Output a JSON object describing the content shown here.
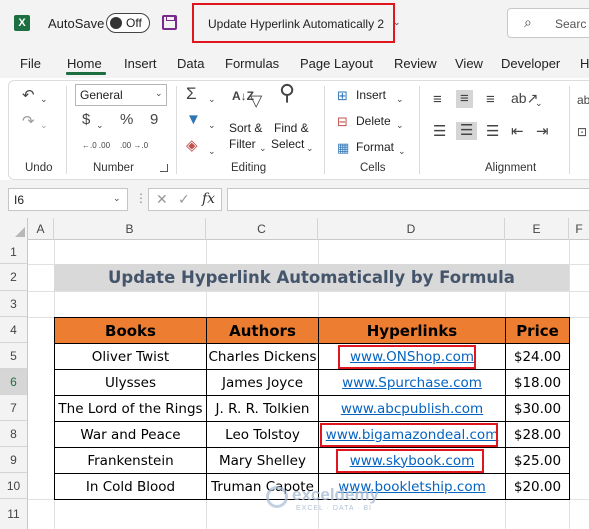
{
  "titlebar": {
    "app_icon": "X",
    "autosave_label": "AutoSave",
    "autosave_state": "Off",
    "document_title": "Update Hyperlink Automatically 2",
    "search_placeholder": "Searc"
  },
  "menu": {
    "tabs": [
      "File",
      "Home",
      "Insert",
      "Data",
      "Formulas",
      "Page Layout",
      "Review",
      "View",
      "Developer",
      "H"
    ],
    "active": "Home"
  },
  "ribbon": {
    "undo": {
      "label": "Undo"
    },
    "number": {
      "format": "General",
      "currency_icon": "$",
      "percent_icon": "%",
      "comma_icon": "9",
      "increase_decimal": "←.0 .00",
      "decrease_decimal": ".00 →.0",
      "label": "Number"
    },
    "editing": {
      "autosum_icon": "Σ",
      "sort_filter": [
        "Sort &",
        "Filter"
      ],
      "find_select": [
        "Find &",
        "Select"
      ],
      "label": "Editing"
    },
    "cells": {
      "insert": "Insert",
      "delete": "Delete",
      "format": "Format",
      "label": "Cells"
    },
    "alignment": {
      "label": "Alignment"
    }
  },
  "formula_bar": {
    "name_box": "I6",
    "fx": "fx",
    "cancel_icon": "✕",
    "enter_icon": "✓",
    "formula": ""
  },
  "grid": {
    "columns": [
      "A",
      "B",
      "C",
      "D",
      "E",
      "F"
    ],
    "rows": [
      "1",
      "2",
      "3",
      "4",
      "5",
      "6",
      "7",
      "8",
      "9",
      "10",
      "11"
    ]
  },
  "sheet": {
    "title": "Update Hyperlink Automatically by Formula",
    "headers": [
      "Books",
      "Authors",
      "Hyperlinks",
      "Price"
    ],
    "rows": [
      {
        "book": "Oliver Twist",
        "author": "Charles Dickens",
        "link": "www.ONShop.com",
        "price": "$24.00"
      },
      {
        "book": "Ulysses",
        "author": "James Joyce",
        "link": "www.Spurchase.com",
        "price": "$18.00"
      },
      {
        "book": "The Lord of the Rings",
        "author": "J. R. R. Tolkien",
        "link": "www.abcpublish.com",
        "price": "$30.00"
      },
      {
        "book": "War and Peace",
        "author": "Leo Tolstoy",
        "link": "www.bigamazondeal.com",
        "price": "$28.00"
      },
      {
        "book": "Frankenstein",
        "author": "Mary Shelley",
        "link": "www.skybook.com",
        "price": "$25.00"
      },
      {
        "book": "In Cold Blood",
        "author": "Truman Capote",
        "link": "www.bookletship.com",
        "price": "$20.00"
      }
    ]
  },
  "watermark": {
    "name": "exceldemy",
    "tagline": "EXCEL · DATA · BI"
  },
  "colors": {
    "header_fill": "#ed7d31",
    "title_fill": "#d9d9d9",
    "title_text": "#44546a",
    "link": "#0563c1",
    "highlight": "#e0151d",
    "excel_green": "#1d6f42"
  }
}
